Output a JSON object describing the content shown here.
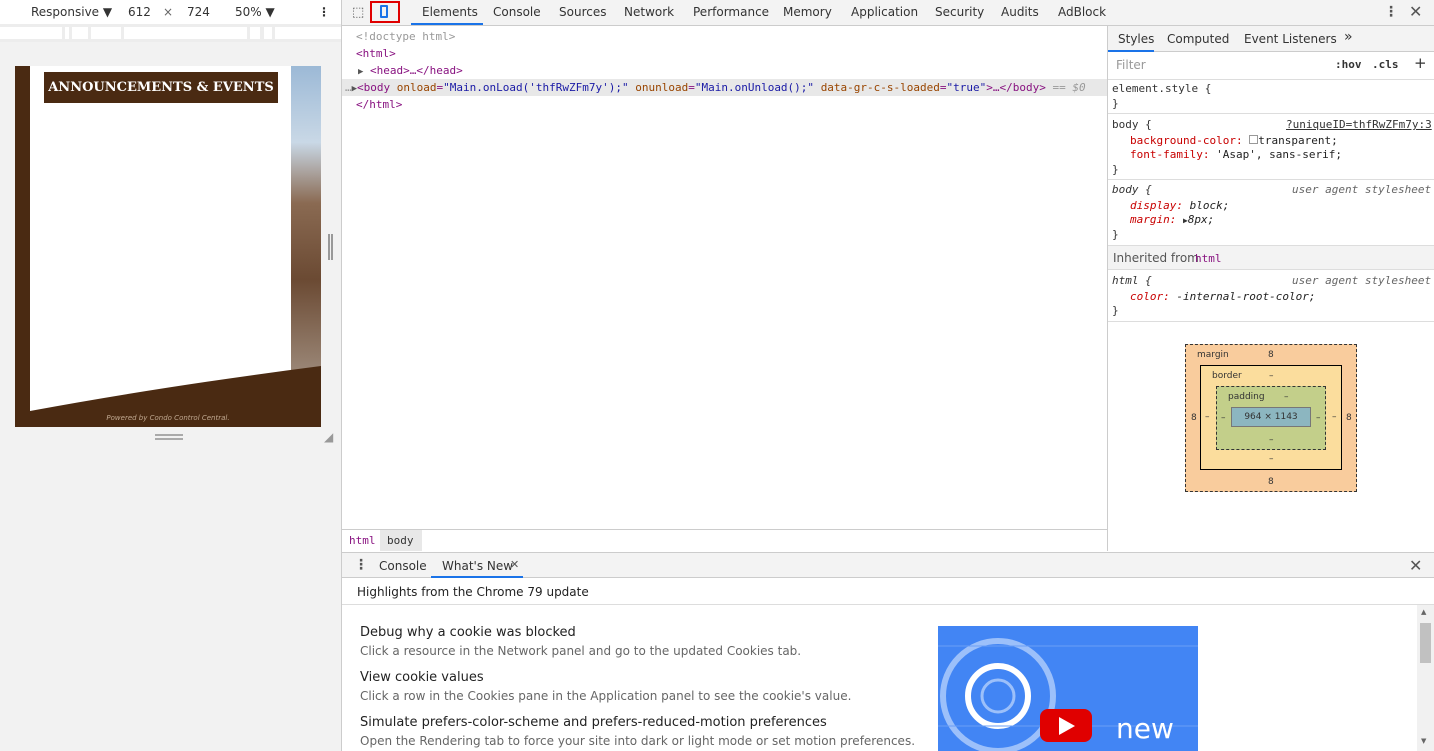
{
  "device_toolbar": {
    "mode": "Responsive",
    "width": "612",
    "times": "×",
    "height": "724",
    "zoom": "50%"
  },
  "page_preview": {
    "banner": "ANNOUNCEMENTS & EVENTS",
    "footer": "Powered by Condo Control Central."
  },
  "devtools_tabs": [
    "Elements",
    "Console",
    "Sources",
    "Network",
    "Performance",
    "Memory",
    "Application",
    "Security",
    "Audits",
    "AdBlock"
  ],
  "active_tab": "Elements",
  "dom": {
    "doctype": "<!doctype html>",
    "html_open": "<html>",
    "head": "<head>…</head>",
    "body_tag": "<body",
    "body_attr1": "onload",
    "body_val1": "\"Main.onLoad('thfRwZFm7y');\"",
    "body_attr2": "onunload",
    "body_val2": "\"Main.onUnload();\"",
    "body_attr3": "data-gr-c-s-loaded",
    "body_val3": "\"true\"",
    "body_close": ">…</body>",
    "selected_marker": "== $0",
    "html_close": "</html>"
  },
  "breadcrumbs": [
    "html",
    "body"
  ],
  "styles_tabs": [
    "Styles",
    "Computed",
    "Event Listeners"
  ],
  "filter_placeholder": "Filter",
  "hov": ":hov",
  "cls": ".cls",
  "rules": {
    "element_style": "element.style {",
    "close": "}",
    "body_sel": "body {",
    "body_src": "?uniqueID=thfRwZFm7y:3",
    "bg_prop": "background-color:",
    "bg_val": "transparent;",
    "ff_prop": "font-family:",
    "ff_val": "'Asap', sans-serif;",
    "ua_body_sel": "body {",
    "ua_src": "user agent stylesheet",
    "display_prop": "display:",
    "display_val": "block;",
    "margin_prop": "margin:",
    "margin_val": "8px;",
    "inherited_label": "Inherited from",
    "inherited_tag": "html",
    "ua_html_sel": "html {",
    "color_prop": "color:",
    "color_val": "-internal-root-color;"
  },
  "box_model": {
    "margin_label": "margin",
    "margin_top": "8",
    "margin_right": "8",
    "margin_bottom": "8",
    "margin_left": "8",
    "border_label": "border",
    "border_val": "–",
    "padding_label": "padding",
    "padding_val": "–",
    "content": "964 × 1143"
  },
  "drawer": {
    "tabs": [
      "Console",
      "What's New"
    ],
    "heading": "Highlights from the Chrome 79 update",
    "items": [
      {
        "title": "Debug why a cookie was blocked",
        "desc": "Click a resource in the Network panel and go to the updated Cookies tab."
      },
      {
        "title": "View cookie values",
        "desc": "Click a row in the Cookies pane in the Application panel to see the cookie's value."
      },
      {
        "title": "Simulate prefers-color-scheme and prefers-reduced-motion preferences",
        "desc": "Open the Rendering tab to force your site into dark or light mode or set motion preferences."
      }
    ],
    "video_word": "new"
  },
  "colors": {
    "brown": "#4a2a12",
    "highlight_red": "#e00000",
    "active_blue": "#1a73e8"
  }
}
